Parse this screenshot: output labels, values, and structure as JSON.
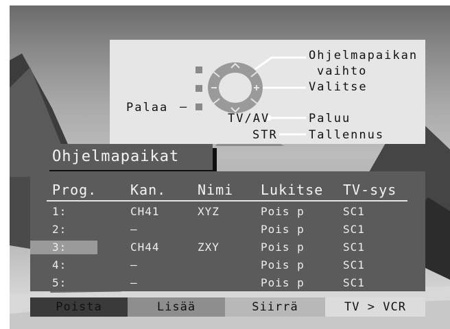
{
  "help": {
    "prog_change_l1": "Ohjelmapaikan",
    "prog_change_l2": "vaihto",
    "select": "Valitse",
    "back": "Palaa",
    "dash": "–",
    "tvav": "TV/AV",
    "str": "STR",
    "return": "Paluu",
    "store": "Tallennus"
  },
  "menu": {
    "title": "Ohjelmapaikat"
  },
  "table": {
    "headers": {
      "prog": "Prog.",
      "kan": "Kan.",
      "nimi": "Nimi",
      "lukitse": "Lukitse",
      "tvsys": "TV-sys"
    },
    "selected_row": 3,
    "rows": [
      {
        "prog": "1:",
        "kan": "CH41",
        "nimi": "XYZ",
        "lukitse": "Pois p",
        "tvsys": "SC1"
      },
      {
        "prog": "2:",
        "kan": "–",
        "nimi": "",
        "lukitse": "Pois p",
        "tvsys": "SC1"
      },
      {
        "prog": "3:",
        "kan": "CH44",
        "nimi": "ZXY",
        "lukitse": "Pois p",
        "tvsys": "SC1"
      },
      {
        "prog": "4:",
        "kan": "–",
        "nimi": "",
        "lukitse": "Pois p",
        "tvsys": "SC1"
      },
      {
        "prog": "5:",
        "kan": "–",
        "nimi": "",
        "lukitse": "Pois p",
        "tvsys": "SC1"
      }
    ]
  },
  "buttons": [
    {
      "label": "Poista",
      "color": "#3a3a3a"
    },
    {
      "label": "Lisää",
      "color": "#8e8e8e"
    },
    {
      "label": "Siirrä",
      "color": "#b8b8b8"
    },
    {
      "label": "TV > VCR",
      "color": "#dcdcdc"
    }
  ]
}
